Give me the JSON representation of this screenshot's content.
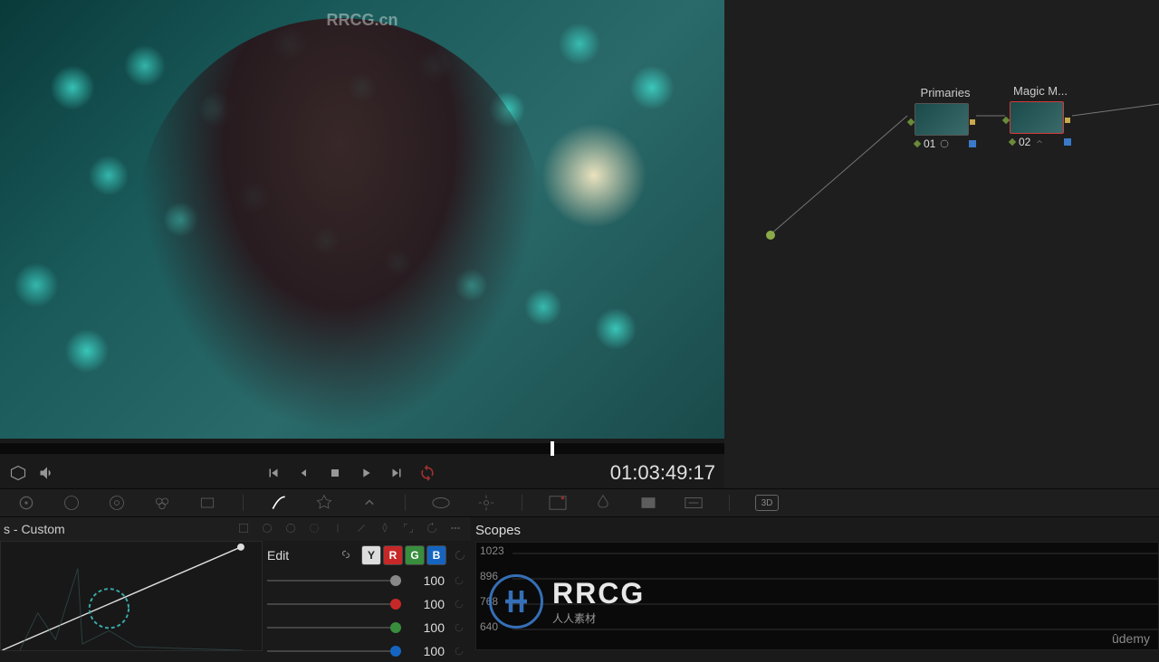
{
  "watermark_top": "RRCG.cn",
  "timecode": "01:03:49:17",
  "nodes": {
    "node1": {
      "label": "Primaries",
      "number": "01"
    },
    "node2": {
      "label": "Magic M...",
      "number": "02"
    }
  },
  "curves_panel": {
    "title": "s - Custom",
    "edit_label": "Edit",
    "channels": {
      "y": "Y",
      "r": "R",
      "g": "G",
      "b": "B"
    },
    "values": {
      "y": "100",
      "r": "100",
      "g": "100",
      "b": "100"
    }
  },
  "scopes": {
    "title": "Scopes",
    "labels": {
      "top": "1023",
      "l1": "896",
      "l2": "768",
      "l3": "640"
    }
  },
  "toolbar_3d": "3D",
  "rrcg": {
    "text": "RRCG",
    "subtitle": "人人素材"
  },
  "udemy": "ûdemy"
}
